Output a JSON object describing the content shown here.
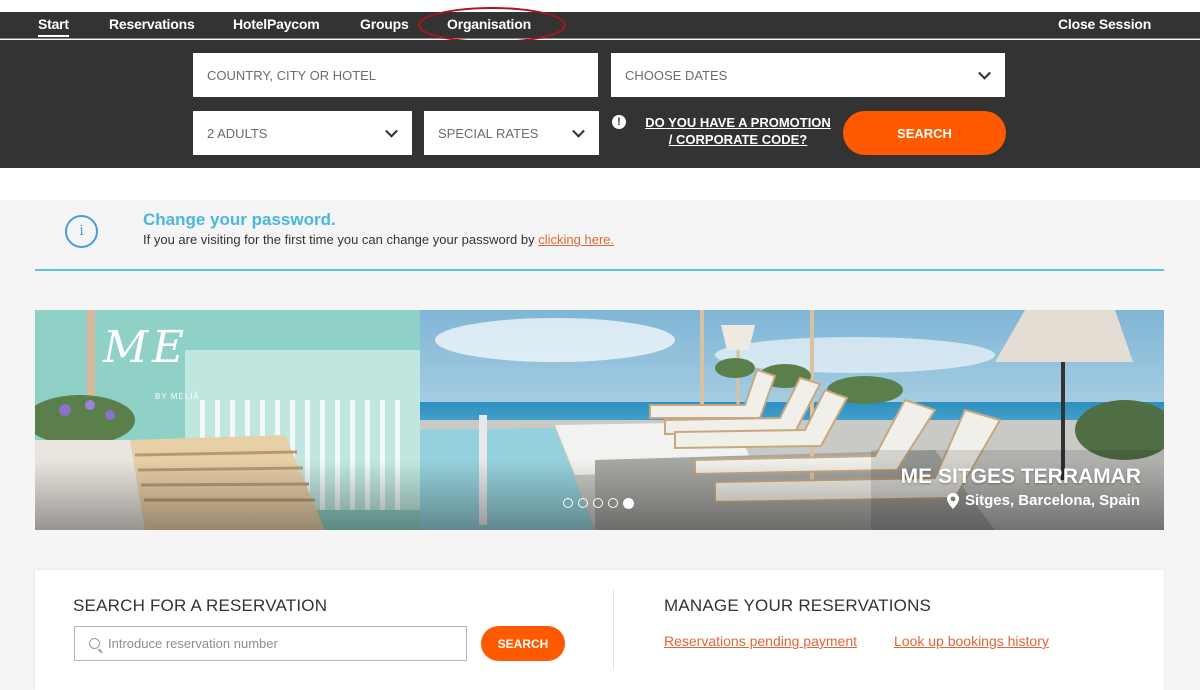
{
  "nav": {
    "items": [
      {
        "label": "Start"
      },
      {
        "label": "Reservations"
      },
      {
        "label": "HotelPaycom"
      },
      {
        "label": "Groups"
      },
      {
        "label": "Organisation"
      }
    ],
    "close_session": "Close Session"
  },
  "search": {
    "destination_placeholder": "COUNTRY, CITY OR HOTEL",
    "dates_label": "CHOOSE DATES",
    "guests_label": "2 ADULTS",
    "rates_label": "SPECIAL RATES",
    "promo_line1": "DO YOU HAVE A PROMOTION",
    "promo_line2": "/ CORPORATE CODE?",
    "button_label": "SEARCH"
  },
  "notice": {
    "title": "Change your password.",
    "text": "If you are visiting for the first time you can change your password by ",
    "link": "clicking here."
  },
  "banner": {
    "brand_logo": "ME",
    "brand_sub": "BY MELIÃ",
    "hotel_name": "ME SITGES TERRAMAR",
    "location": "Sitges, Barcelona, Spain",
    "slides_total": 5,
    "active_slide": 5
  },
  "reservation": {
    "search_title": "SEARCH FOR A RESERVATION",
    "input_placeholder": "Introduce reservation number",
    "search_button": "SEARCH",
    "manage_title": "MANAGE YOUR RESERVATIONS",
    "link_pending": "Reservations pending payment",
    "link_history": "Look up bookings history"
  },
  "colors": {
    "accent": "#ff5a00",
    "nav_bg": "#333333",
    "notice_blue": "#4bb6e0",
    "link_orange": "#e0663a",
    "highlight_ring": "#b3121b"
  }
}
